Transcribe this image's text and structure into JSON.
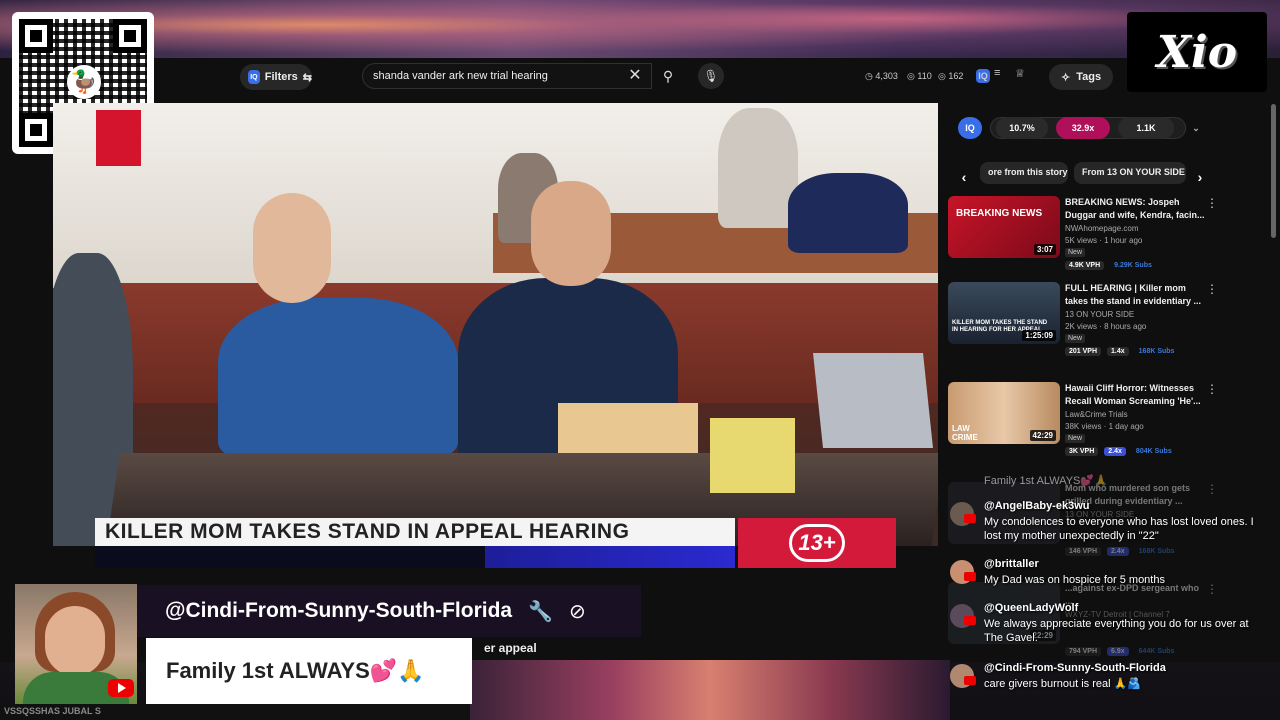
{
  "search": {
    "query": "shanda vander ark new trial hearing"
  },
  "toolbar": {
    "filters_label": "Filters",
    "stat_views": "4,303",
    "stat_likes": "110",
    "stat_comments": "162",
    "tags_label": "Tags"
  },
  "video": {
    "lower_third": "KILLER MOM TAKES STAND IN APPEAL HEARING",
    "station": "13+"
  },
  "sidebar": {
    "stats": {
      "iq": "IQ",
      "pct": "10.7%",
      "ratio": "32.9x",
      "count": "1.1K"
    },
    "chips": [
      "ore from this story",
      "From 13 ON YOUR SIDE"
    ],
    "videos": [
      {
        "title": "BREAKING NEWS: Jospeh Duggar and wife, Kendra, facin...",
        "channel": "NWAhomepage.com",
        "meta": "5K views · 1 hour ago",
        "badge": "New",
        "duration": "3:07",
        "vph": "4.9K VPH",
        "ratio": "",
        "subs": "9.29K Subs",
        "thumb_text": "BREAKING NEWS"
      },
      {
        "title": "FULL HEARING | Killer mom takes the stand in evidentiary ...",
        "channel": "13 ON YOUR SIDE",
        "meta": "2K views · 8 hours ago",
        "badge": "New",
        "duration": "1:25:09",
        "vph": "201 VPH",
        "ratio": "1.4x",
        "subs": "168K Subs",
        "thumb_text": "KILLER MOM TAKES THE STAND IN HEARING FOR HER APPEAL"
      },
      {
        "title": "Hawaii Cliff Horror: Witnesses Recall Woman Screaming 'He'...",
        "channel": "Law&Crime Trials",
        "meta": "38K views · 1 day ago",
        "badge": "New",
        "duration": "42:29",
        "vph": "3K VPH",
        "ratio": "2.4x",
        "subs": "804K Subs",
        "thumb_text": "LAW CRIME"
      },
      {
        "title": "Mom who murdered son gets grilled during evidentiary ...",
        "channel": "13 ON YOUR SIDE",
        "meta": "",
        "badge": "",
        "duration": "",
        "vph": "146 VPH",
        "ratio": "2.4x",
        "subs": "168K Subs",
        "thumb_text": ""
      },
      {
        "title": "...against ex-DPD sergeant who ...",
        "channel": "WXYZ-TV Detroit | Channel 7",
        "meta": "",
        "badge": "",
        "duration": "22:29",
        "vph": "794 VPH",
        "ratio": "6.9x",
        "subs": "644K Subs",
        "thumb_text": ""
      }
    ]
  },
  "chat": {
    "header": "Family 1st ALWAYS💕🙏",
    "messages": [
      {
        "name": "@AngelBaby-ek3wu",
        "text": "My condolences to everyone who has lost loved ones. I lost my mother unexpectedly in \"22\""
      },
      {
        "name": "@brittaller",
        "text": "My Dad was on hospice for 5 months"
      },
      {
        "name": "@QueenLadyWolf",
        "text": "We always appreciate everything you do for us over at The Gavel."
      },
      {
        "name": "@Cindi-From-Sunny-South-Florida",
        "text": "care givers burnout is real 🙏🫂"
      }
    ]
  },
  "host": {
    "name": "@Cindi-From-Sunny-South-Florida",
    "message": "Family 1st ALWAYS💕🙏",
    "appeal": "er appeal",
    "bottom_strip": "VSSQSSHAS JUBAL S"
  },
  "logos": {
    "xio": "Xio"
  },
  "colors": {
    "accent_red": "#d41a3a",
    "ratio_pink": "#b0105a",
    "chat_highlight": "#3a50d8"
  }
}
